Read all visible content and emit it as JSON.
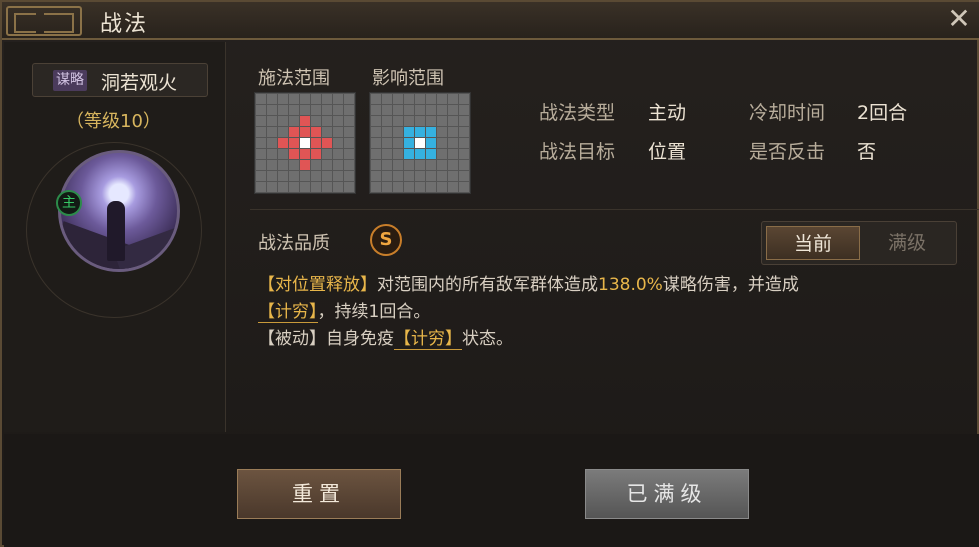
{
  "window": {
    "title": "战法",
    "close_icon": "close-icon"
  },
  "skill": {
    "tag": "谋略",
    "name": "洞若观火",
    "level": "（等级10）",
    "main_badge": "主"
  },
  "ranges": {
    "cast_label": "施法范围",
    "effect_label": "影响范围",
    "cast_grid": {
      "size": 9,
      "highlight_color": "#e05555",
      "cells": [
        [
          2,
          4
        ],
        [
          3,
          3
        ],
        [
          3,
          4
        ],
        [
          3,
          5
        ],
        [
          4,
          2
        ],
        [
          4,
          3
        ],
        [
          4,
          5
        ],
        [
          4,
          6
        ],
        [
          5,
          3
        ],
        [
          5,
          4
        ],
        [
          5,
          5
        ],
        [
          6,
          4
        ]
      ],
      "center": [
        4,
        4
      ]
    },
    "effect_grid": {
      "size": 9,
      "highlight_color": "#35b1e0",
      "cells": [
        [
          3,
          3
        ],
        [
          3,
          4
        ],
        [
          3,
          5
        ],
        [
          4,
          3
        ],
        [
          4,
          5
        ],
        [
          5,
          3
        ],
        [
          5,
          4
        ],
        [
          5,
          5
        ]
      ],
      "center": [
        4,
        4
      ]
    }
  },
  "attributes": {
    "type_label": "战法类型",
    "type_value": "主动",
    "cooldown_label": "冷却时间",
    "cooldown_value": "2回合",
    "target_label": "战法目标",
    "target_value": "位置",
    "counter_label": "是否反击",
    "counter_value": "否"
  },
  "quality": {
    "label": "战法品质",
    "grade": "S"
  },
  "toggle": {
    "current": "当前",
    "max": "满级",
    "active": "current"
  },
  "description": {
    "line1_tag": "【对位置释放】",
    "line1_text_a": "对范围内的所有敌军群体造成",
    "line1_pct": "138.0%",
    "line1_text_b": "谋略伤害，并造成",
    "line2_kw": "【计穷】",
    "line2_text": "，持续1回合。",
    "line3_prefix": "【被动】自身免疫",
    "line3_kw": "【计穷】",
    "line3_text": "状态。"
  },
  "buttons": {
    "reset": "重置",
    "maxed": "已满级"
  }
}
